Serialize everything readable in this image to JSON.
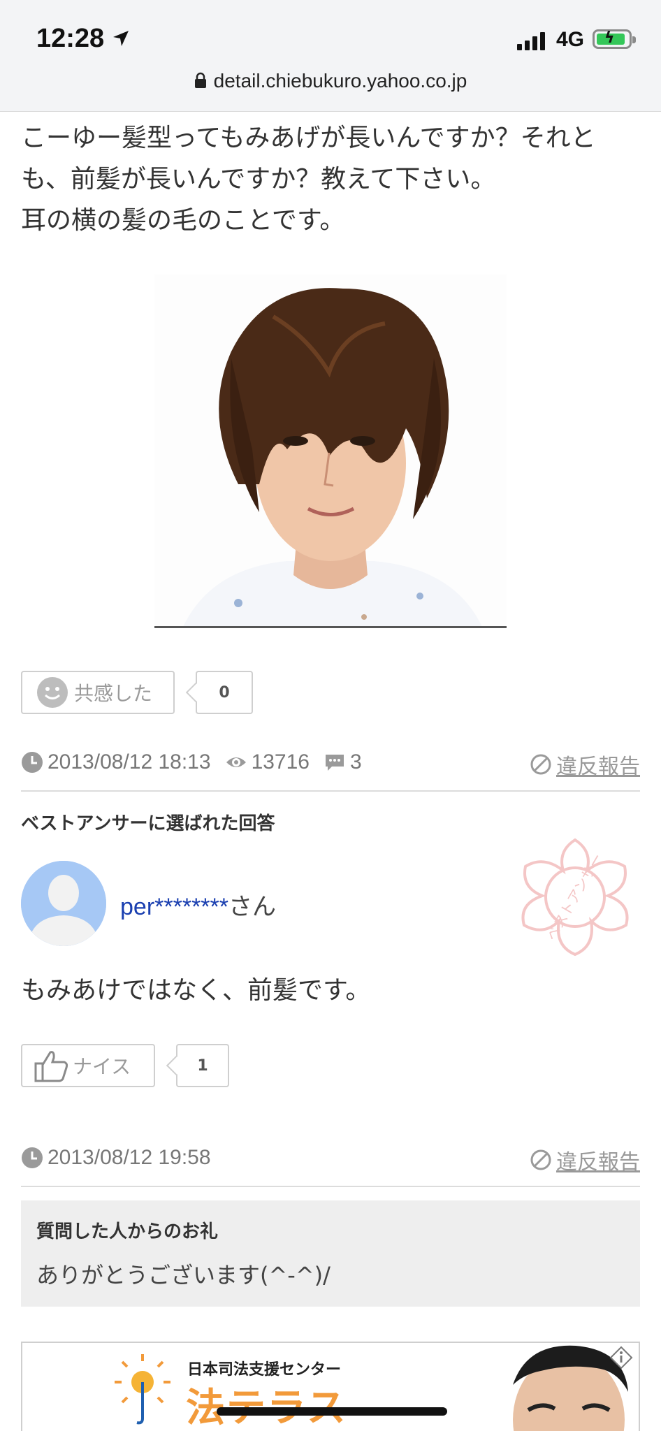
{
  "status_bar": {
    "time": "12:28",
    "network": "4G",
    "url": "detail.chiebukuro.yahoo.co.jp"
  },
  "question": {
    "lines": [
      "こーゆー髪型ってもみあげが長いんですか？それと",
      "も、前髪が長いんですか？教えて下さい。",
      "耳の横の髪の毛のことです。"
    ],
    "empathy_label": "共感した",
    "empathy_count": "0",
    "date": "2013/08/12 18:13",
    "views": "13716",
    "answers": "3",
    "report_label": "違反報告"
  },
  "best_answer": {
    "section_title": "ベストアンサーに選ばれた回答",
    "user_name": "per********",
    "user_suffix": "さん",
    "stamp_text": "ベストアンサー",
    "text": "もみあけではなく、前髪です。",
    "nice_label": "ナイス",
    "nice_count": "1",
    "date": "2013/08/12 19:58",
    "report_label": "違反報告"
  },
  "thanks": {
    "title": "質問した人からのお礼",
    "text": "ありがとうございます(^-^)/"
  },
  "ad": {
    "subtitle": "日本司法支援センター",
    "title": "法テラス"
  },
  "colors": {
    "link_blue": "#1a3fb0",
    "stamp_pink": "#f4c6c6",
    "accent_orange": "#f29a3a"
  }
}
